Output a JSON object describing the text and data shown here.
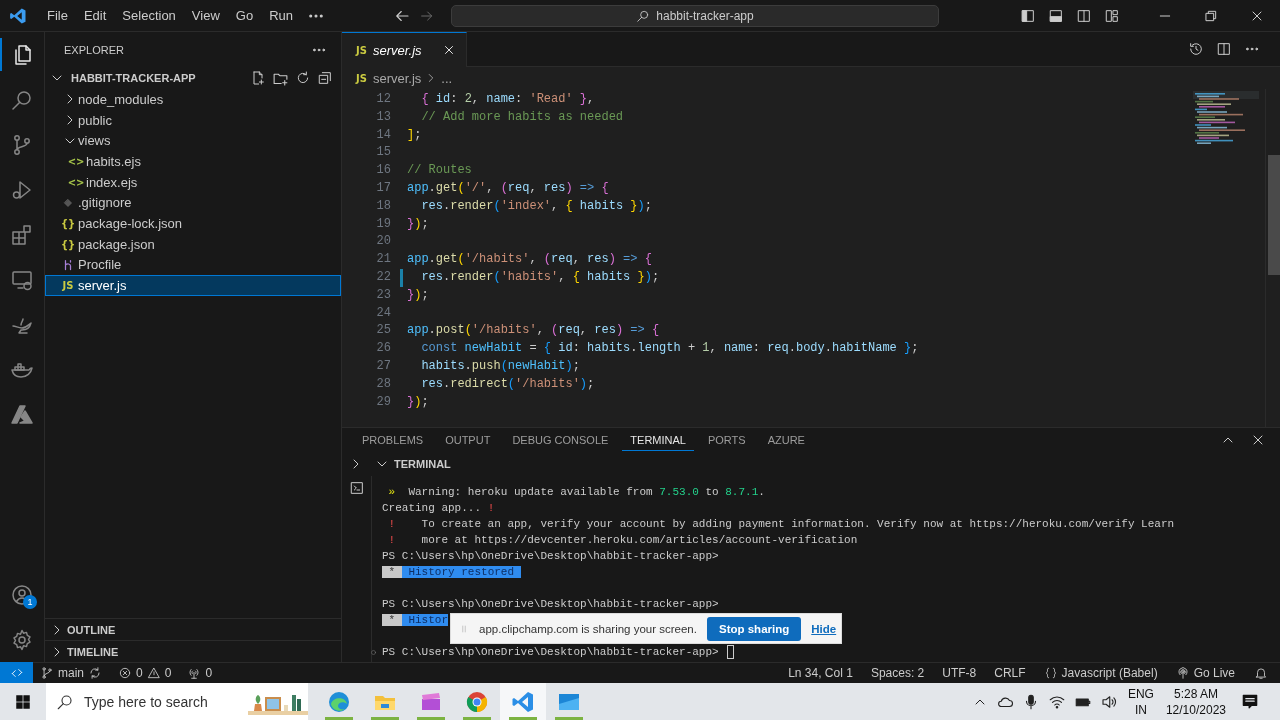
{
  "title_bar": {
    "menu": [
      "File",
      "Edit",
      "Selection",
      "View",
      "Go",
      "Run"
    ],
    "command_center": "habbit-tracker-app"
  },
  "activity_bar": {
    "top": [
      {
        "kind": "explorer",
        "selected": true
      },
      {
        "kind": "search",
        "selected": false
      },
      {
        "kind": "source-control",
        "selected": false
      },
      {
        "kind": "run-debug",
        "selected": false
      },
      {
        "kind": "extensions",
        "selected": false
      },
      {
        "kind": "remote",
        "selected": false
      },
      {
        "kind": "lamp",
        "selected": false
      },
      {
        "kind": "whale",
        "selected": false
      },
      {
        "kind": "azure",
        "selected": false
      }
    ],
    "bottom": [
      {
        "kind": "accounts",
        "badge": "1"
      },
      {
        "kind": "settings"
      }
    ]
  },
  "sidebar": {
    "title": "EXPLORER",
    "folder": {
      "label": "HABBIT-TRACKER-APP",
      "expanded": true
    },
    "tree": [
      {
        "label": "node_modules",
        "kind": "folder",
        "expanded": false,
        "selected": false
      },
      {
        "label": "public",
        "kind": "folder",
        "expanded": false,
        "selected": false
      },
      {
        "label": "views",
        "kind": "folder",
        "expanded": true,
        "selected": false,
        "children": [
          {
            "label": "habits.ejs",
            "kind": "ejs",
            "icon": "<>",
            "selected": false
          },
          {
            "label": "index.ejs",
            "kind": "ejs",
            "icon": "<>",
            "selected": false
          }
        ]
      },
      {
        "label": ".gitignore",
        "kind": "gitignore",
        "selected": false
      },
      {
        "label": "package-lock.json",
        "kind": "json",
        "icon": "{}",
        "selected": false
      },
      {
        "label": "package.json",
        "kind": "json",
        "icon": "{}",
        "selected": false
      },
      {
        "label": "Procfile",
        "kind": "procfile",
        "selected": false
      },
      {
        "label": "server.js",
        "kind": "js",
        "icon": "JS",
        "selected": true
      }
    ],
    "sections": [
      {
        "label": "OUTLINE",
        "expanded": false
      },
      {
        "label": "TIMELINE",
        "expanded": false
      }
    ]
  },
  "editor": {
    "tabs": [
      {
        "label": "server.js",
        "icon": "JS",
        "preview": true,
        "selected": true
      }
    ],
    "breadcrumb": {
      "icon": "JS",
      "items": [
        "server.js",
        "..."
      ]
    },
    "lines": [
      {
        "number": "12",
        "modified": false,
        "tokens": [
          {
            "text": "  {",
            "kind": "bracket2"
          },
          {
            "text": " id",
            "kind": "var"
          },
          {
            "text": ": ",
            "kind": "plain"
          },
          {
            "text": "2",
            "kind": "number"
          },
          {
            "text": ", ",
            "kind": "plain"
          },
          {
            "text": "name",
            "kind": "var"
          },
          {
            "text": ": ",
            "kind": "plain"
          },
          {
            "text": "'Read'",
            "kind": "string"
          },
          {
            "text": " }",
            "kind": "bracket2"
          },
          {
            "text": ",",
            "kind": "plain"
          }
        ]
      },
      {
        "number": "13",
        "modified": false,
        "tokens": [
          {
            "text": "  // Add more habits as needed",
            "kind": "comment"
          }
        ]
      },
      {
        "number": "14",
        "modified": false,
        "tokens": [
          {
            "text": "]",
            "kind": "bracket1"
          },
          {
            "text": ";",
            "kind": "plain"
          }
        ]
      },
      {
        "number": "15",
        "modified": false
      },
      {
        "number": "16",
        "modified": false,
        "tokens": [
          {
            "text": "// Routes",
            "kind": "comment"
          }
        ]
      },
      {
        "number": "17",
        "modified": false,
        "tokens": [
          {
            "text": "app",
            "kind": "const"
          },
          {
            "text": ".",
            "kind": "plain"
          },
          {
            "text": "get",
            "kind": "func"
          },
          {
            "text": "(",
            "kind": "bracket1"
          },
          {
            "text": "'/'",
            "kind": "string"
          },
          {
            "text": ", ",
            "kind": "plain"
          },
          {
            "text": "(",
            "kind": "bracket2"
          },
          {
            "text": "req",
            "kind": "var"
          },
          {
            "text": ", ",
            "kind": "plain"
          },
          {
            "text": "res",
            "kind": "var"
          },
          {
            "text": ")",
            "kind": "bracket2"
          },
          {
            "text": " =>",
            "kind": "keyword"
          },
          {
            "text": " {",
            "kind": "bracket2"
          }
        ]
      },
      {
        "number": "18",
        "modified": false,
        "tokens": [
          {
            "text": "  res",
            "kind": "var"
          },
          {
            "text": ".",
            "kind": "plain"
          },
          {
            "text": "render",
            "kind": "func"
          },
          {
            "text": "(",
            "kind": "bracket3"
          },
          {
            "text": "'index'",
            "kind": "string"
          },
          {
            "text": ", ",
            "kind": "plain"
          },
          {
            "text": "{",
            "kind": "bracket1"
          },
          {
            "text": " habits",
            "kind": "var"
          },
          {
            "text": " }",
            "kind": "bracket1"
          },
          {
            "text": ")",
            "kind": "bracket3"
          },
          {
            "text": ";",
            "kind": "plain"
          }
        ]
      },
      {
        "number": "19",
        "modified": false,
        "tokens": [
          {
            "text": "}",
            "kind": "bracket2"
          },
          {
            "text": ")",
            "kind": "bracket1"
          },
          {
            "text": ";",
            "kind": "plain"
          }
        ]
      },
      {
        "number": "20",
        "modified": false
      },
      {
        "number": "21",
        "modified": false,
        "tokens": [
          {
            "text": "app",
            "kind": "const"
          },
          {
            "text": ".",
            "kind": "plain"
          },
          {
            "text": "get",
            "kind": "func"
          },
          {
            "text": "(",
            "kind": "bracket1"
          },
          {
            "text": "'/habits'",
            "kind": "string"
          },
          {
            "text": ", ",
            "kind": "plain"
          },
          {
            "text": "(",
            "kind": "bracket2"
          },
          {
            "text": "req",
            "kind": "var"
          },
          {
            "text": ", ",
            "kind": "plain"
          },
          {
            "text": "res",
            "kind": "var"
          },
          {
            "text": ")",
            "kind": "bracket2"
          },
          {
            "text": " =>",
            "kind": "keyword"
          },
          {
            "text": " {",
            "kind": "bracket2"
          }
        ]
      },
      {
        "number": "22",
        "modified": true,
        "tokens": [
          {
            "text": "  res",
            "kind": "var"
          },
          {
            "text": ".",
            "kind": "plain"
          },
          {
            "text": "render",
            "kind": "func"
          },
          {
            "text": "(",
            "kind": "bracket3"
          },
          {
            "text": "'habits'",
            "kind": "string"
          },
          {
            "text": ", ",
            "kind": "plain"
          },
          {
            "text": "{",
            "kind": "bracket1"
          },
          {
            "text": " habits",
            "kind": "var"
          },
          {
            "text": " }",
            "kind": "bracket1"
          },
          {
            "text": ")",
            "kind": "bracket3"
          },
          {
            "text": ";",
            "kind": "plain"
          }
        ]
      },
      {
        "number": "23",
        "modified": false,
        "tokens": [
          {
            "text": "}",
            "kind": "bracket2"
          },
          {
            "text": ")",
            "kind": "bracket1"
          },
          {
            "text": ";",
            "kind": "plain"
          }
        ]
      },
      {
        "number": "24",
        "modified": false
      },
      {
        "number": "25",
        "modified": false,
        "tokens": [
          {
            "text": "app",
            "kind": "const"
          },
          {
            "text": ".",
            "kind": "plain"
          },
          {
            "text": "post",
            "kind": "func"
          },
          {
            "text": "(",
            "kind": "bracket1"
          },
          {
            "text": "'/habits'",
            "kind": "string"
          },
          {
            "text": ", ",
            "kind": "plain"
          },
          {
            "text": "(",
            "kind": "bracket2"
          },
          {
            "text": "req",
            "kind": "var"
          },
          {
            "text": ", ",
            "kind": "plain"
          },
          {
            "text": "res",
            "kind": "var"
          },
          {
            "text": ")",
            "kind": "bracket2"
          },
          {
            "text": " =>",
            "kind": "keyword"
          },
          {
            "text": " {",
            "kind": "bracket2"
          }
        ]
      },
      {
        "number": "26",
        "modified": false,
        "tokens": [
          {
            "text": "  const",
            "kind": "keyword"
          },
          {
            "text": " newHabit",
            "kind": "const"
          },
          {
            "text": " = ",
            "kind": "plain"
          },
          {
            "text": "{",
            "kind": "bracket3"
          },
          {
            "text": " id",
            "kind": "var"
          },
          {
            "text": ": ",
            "kind": "plain"
          },
          {
            "text": "habits",
            "kind": "var"
          },
          {
            "text": ".",
            "kind": "plain"
          },
          {
            "text": "length",
            "kind": "var"
          },
          {
            "text": " + ",
            "kind": "plain"
          },
          {
            "text": "1",
            "kind": "number"
          },
          {
            "text": ", ",
            "kind": "plain"
          },
          {
            "text": "name",
            "kind": "var"
          },
          {
            "text": ": ",
            "kind": "plain"
          },
          {
            "text": "req",
            "kind": "var"
          },
          {
            "text": ".",
            "kind": "plain"
          },
          {
            "text": "body",
            "kind": "var"
          },
          {
            "text": ".",
            "kind": "plain"
          },
          {
            "text": "habitName",
            "kind": "var"
          },
          {
            "text": " }",
            "kind": "bracket3"
          },
          {
            "text": ";",
            "kind": "plain"
          }
        ]
      },
      {
        "number": "27",
        "modified": false,
        "tokens": [
          {
            "text": "  habits",
            "kind": "var"
          },
          {
            "text": ".",
            "kind": "plain"
          },
          {
            "text": "push",
            "kind": "func"
          },
          {
            "text": "(",
            "kind": "bracket3"
          },
          {
            "text": "newHabit",
            "kind": "const"
          },
          {
            "text": ")",
            "kind": "bracket3"
          },
          {
            "text": ";",
            "kind": "plain"
          }
        ]
      },
      {
        "number": "28",
        "modified": false,
        "tokens": [
          {
            "text": "  res",
            "kind": "var"
          },
          {
            "text": ".",
            "kind": "plain"
          },
          {
            "text": "redirect",
            "kind": "func"
          },
          {
            "text": "(",
            "kind": "bracket3"
          },
          {
            "text": "'/habits'",
            "kind": "string"
          },
          {
            "text": ")",
            "kind": "bracket3"
          },
          {
            "text": ";",
            "kind": "plain"
          }
        ]
      },
      {
        "number": "29",
        "modified": false,
        "tokens": [
          {
            "text": "}",
            "kind": "bracket2"
          },
          {
            "text": ")",
            "kind": "bracket1"
          },
          {
            "text": ";",
            "kind": "plain"
          }
        ]
      }
    ]
  },
  "panel": {
    "tabs": [
      {
        "label": "PROBLEMS",
        "selected": false
      },
      {
        "label": "OUTPUT",
        "selected": false
      },
      {
        "label": "DEBUG CONSOLE",
        "selected": false
      },
      {
        "label": "TERMINAL",
        "selected": true
      },
      {
        "label": "PORTS",
        "selected": false
      },
      {
        "label": "AZURE",
        "selected": false
      }
    ],
    "section": {
      "label": "TERMINAL",
      "expanded": true
    },
    "terminal_lines": [
      {
        "tokens": [
          {
            "text": " »",
            "kind": "marker"
          },
          {
            "text": "  Warning: heroku update available from ",
            "kind": "plain"
          },
          {
            "text": "7.53.0",
            "kind": "version"
          },
          {
            "text": " to ",
            "kind": "plain"
          },
          {
            "text": "8.7.1",
            "kind": "version"
          },
          {
            "text": ".",
            "kind": "plain"
          }
        ]
      },
      {
        "tokens": [
          {
            "text": "Creating app... ",
            "kind": "plain"
          },
          {
            "text": "!",
            "kind": "error"
          }
        ]
      },
      {
        "tokens": [
          {
            "text": " !",
            "kind": "error"
          },
          {
            "text": "    To create an app, verify your account by adding payment information. Verify now at https://heroku.com/verify Learn",
            "kind": "plain"
          }
        ]
      },
      {
        "tokens": [
          {
            "text": " !",
            "kind": "error"
          },
          {
            "text": "    more at https://devcenter.heroku.com/articles/account-verification",
            "kind": "plain"
          }
        ]
      },
      {
        "tokens": [
          {
            "text": "PS C:\\Users\\hp\\OneDrive\\Desktop\\habbit-tracker-app>",
            "kind": "plain"
          }
        ]
      },
      {
        "tokens": [
          {
            "text": " * ",
            "kind": "selection-mark"
          },
          {
            "text": " History restored ",
            "kind": "selection"
          }
        ]
      },
      {
        "blank_before": true,
        "tokens": [
          {
            "text": "PS C:\\Users\\hp\\OneDrive\\Desktop\\habbit-tracker-app>",
            "kind": "plain"
          }
        ]
      },
      {
        "share_bar": true,
        "tokens": [
          {
            "text": " * ",
            "kind": "selection-mark"
          },
          {
            "text": " Histor",
            "kind": "selection"
          }
        ]
      },
      {
        "blank_before": true,
        "decorated": true,
        "cursor": true,
        "tokens": [
          {
            "text": "PS C:\\Users\\hp\\OneDrive\\Desktop\\habbit-tracker-app>",
            "kind": "plain"
          }
        ]
      }
    ],
    "share_bar": {
      "message": "app.clipchamp.com is sharing your screen.",
      "stop_button": "Stop sharing",
      "hide_link": "Hide"
    }
  },
  "status_bar": {
    "branch": "main",
    "errors": "0",
    "warnings": "0",
    "ports": "0",
    "items": [
      "Ln 34, Col 1",
      "Spaces: 2",
      "UTF-8",
      "CRLF"
    ],
    "language": "Javascript (Babel)",
    "go_live": "Go Live"
  },
  "taskbar": {
    "search_placeholder": "Type here to search",
    "apps": [
      {
        "kind": "edge",
        "running": true,
        "active": false
      },
      {
        "kind": "files",
        "running": true,
        "active": false
      },
      {
        "kind": "clapper",
        "running": true,
        "active": false
      },
      {
        "kind": "chrome",
        "running": true,
        "active": false
      },
      {
        "kind": "vscode",
        "running": true,
        "active": true
      },
      {
        "kind": "window",
        "running": true,
        "active": false
      }
    ],
    "input_language": [
      "ENG",
      "IN"
    ],
    "time": "5:28 AM",
    "date": "12/10/2023"
  }
}
